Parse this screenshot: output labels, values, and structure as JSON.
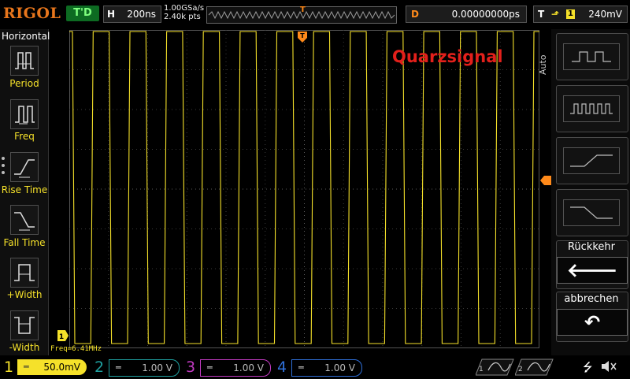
{
  "topbar": {
    "logo": "RIGOL",
    "run_status": "T'D",
    "horizontal": {
      "label": "H",
      "value": "200ns"
    },
    "sample_rate": "1.00GSa/s",
    "memory_depth": "2.40k pts",
    "trigger_marker": "T",
    "delay": {
      "label": "D",
      "value": "0.00000000ps"
    },
    "trigger": {
      "label": "T",
      "edge_icon": "rising-edge-icon",
      "channel": "1",
      "level": "240mV"
    }
  },
  "left_menu": {
    "title": "Horizontal",
    "items": [
      {
        "label": "Period",
        "icon": "period-icon"
      },
      {
        "label": "Freq",
        "icon": "frequency-icon"
      },
      {
        "label": "Rise Time",
        "icon": "rise-time-icon"
      },
      {
        "label": "Fall Time",
        "icon": "fall-time-icon"
      },
      {
        "label": "+Width",
        "icon": "positive-width-icon"
      },
      {
        "label": "-Width",
        "icon": "negative-width-icon"
      }
    ]
  },
  "screen": {
    "annotation": "Quarzsignal",
    "measurement": "Freq=6.41MHz",
    "waveform_color": "#f5e12a",
    "grid_color": "#3a3a3a"
  },
  "right_menu": {
    "mode": "Auto",
    "options": [
      "square-wave-icon",
      "pulse-train-icon",
      "rising-edge-icon",
      "falling-edge-icon"
    ],
    "back_label": "Rückkehr",
    "cancel_label": "abbrechen"
  },
  "bottombar": {
    "channels": [
      {
        "num": "1",
        "scale": "50.0mV",
        "color": "#f5e12a",
        "active": true
      },
      {
        "num": "2",
        "scale": "1.00 V",
        "color": "#1fa0a0",
        "active": false
      },
      {
        "num": "3",
        "scale": "1.00 V",
        "color": "#c23bc2",
        "active": false
      },
      {
        "num": "4",
        "scale": "1.00 V",
        "color": "#2f6fd8",
        "active": false
      }
    ],
    "math1": "1",
    "math2": "2"
  }
}
